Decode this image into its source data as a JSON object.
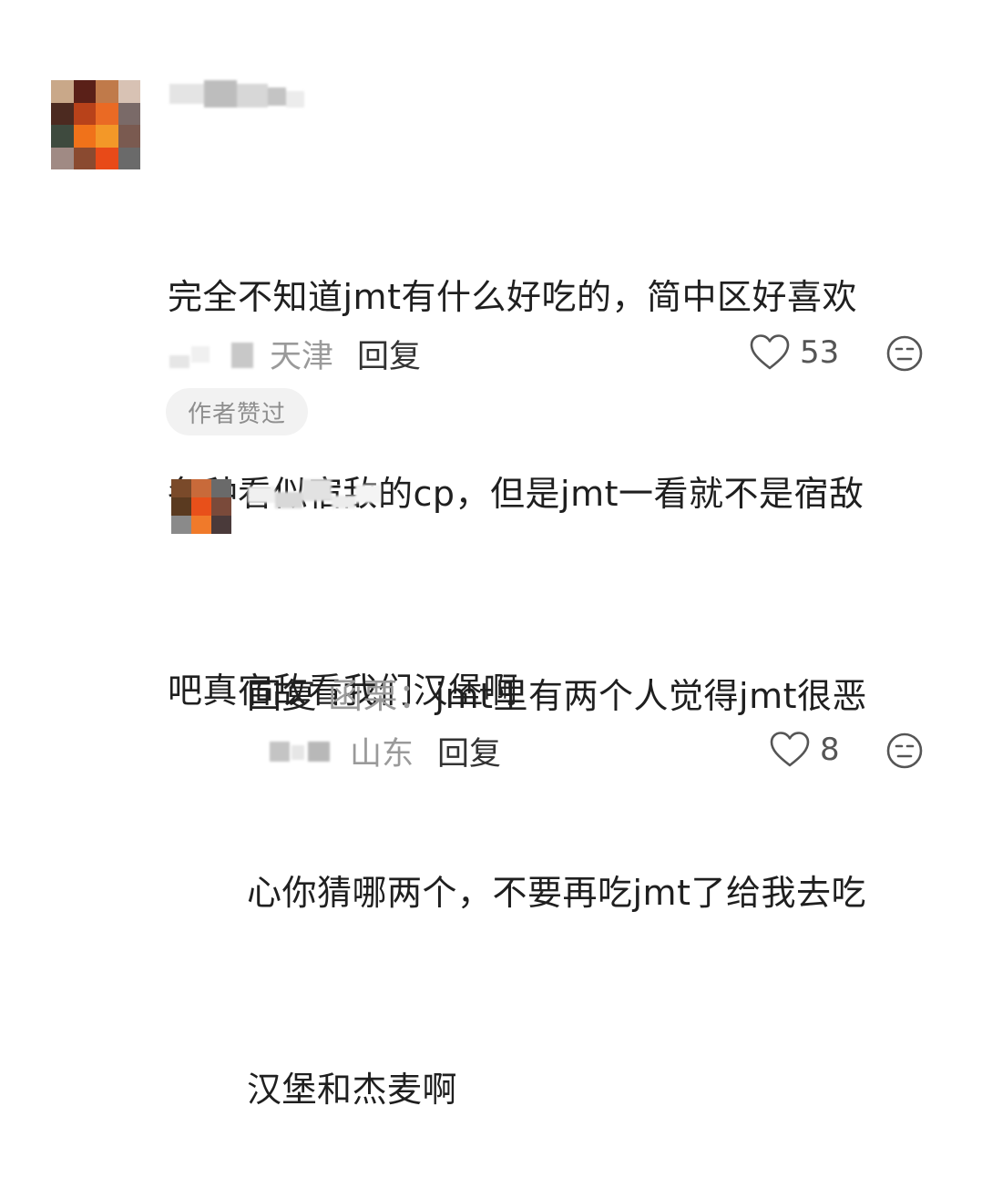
{
  "main_comment": {
    "lines": [
      "完全不知道jmt有什么好吃的，简中区好喜欢",
      "各种看似宿敌的cp，但是jmt一看就不是宿敌",
      "吧真宿敌看我们汉堡啊"
    ],
    "location": "天津",
    "reply_label": "回复",
    "like_count": "53",
    "author_badge": "作者赞过",
    "icons": {
      "like": "heart-outline-icon",
      "reaction": "neutral-face-icon"
    }
  },
  "reply_comment": {
    "prefix": "回复",
    "target": "函栗：",
    "lines": [
      "jmt里有两个人觉得jmt很恶",
      "心你猜哪两个，不要再吃jmt了给我去吃",
      "汉堡和杰麦啊"
    ],
    "location": "山东",
    "reply_label": "回复",
    "like_count": "8",
    "icons": {
      "like": "heart-outline-icon",
      "reaction": "neutral-face-icon"
    }
  },
  "colors": {
    "text_primary": "#1f1f1f",
    "text_secondary": "#9a9a9a",
    "badge_bg": "#f2f2f2",
    "avatar_main_pixels": [
      "#c9a889",
      "#5a2018",
      "#c07a4a",
      "#d8c2b4",
      "#4c2a20",
      "#b8421a",
      "#ea6a24",
      "#7a6a68",
      "#3e4a3e",
      "#f0721a",
      "#f39828",
      "#7a5a50",
      "#a08a84",
      "#8a4a30",
      "#e84a18",
      "#6a6a6a"
    ],
    "avatar_reply_pixels": [
      "#7a4a2a",
      "#c86a3a",
      "#6a6a6a",
      "#5a3a20",
      "#e8501a",
      "#7a4a3a",
      "#8a8a8a",
      "#f07a2a",
      "#4a3a3a"
    ]
  }
}
